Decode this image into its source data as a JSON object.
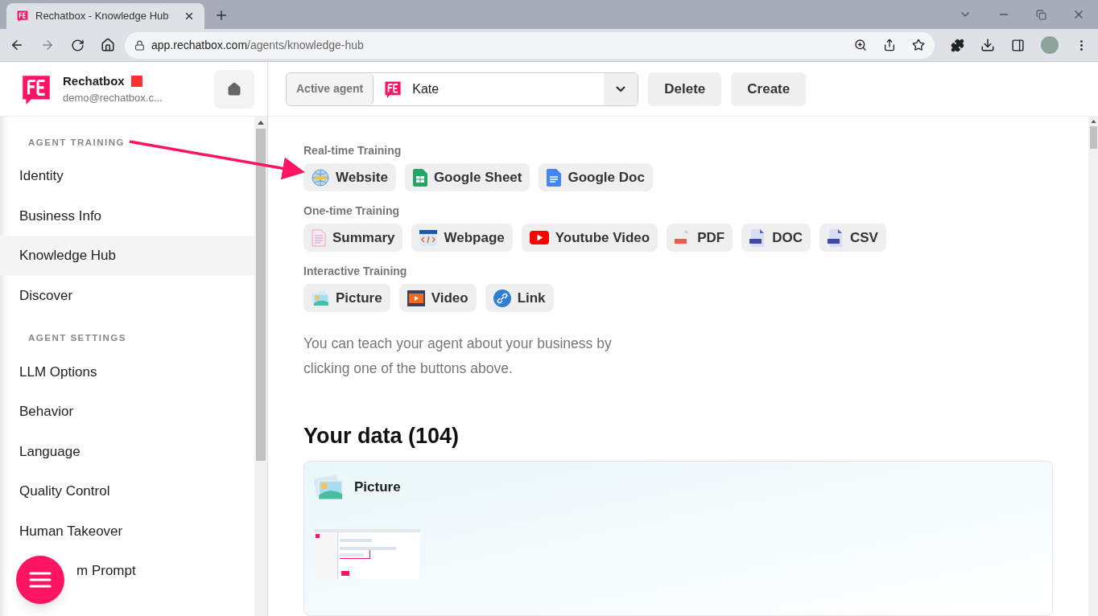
{
  "browser": {
    "tab_title": "Rechatbox - Knowledge Hub",
    "url_host": "app.rechatbox.com",
    "url_path": "/agents/knowledge-hub"
  },
  "brand": {
    "name": "Rechatbox",
    "email": "demo@rechatbox.c..."
  },
  "sidebar": [
    {
      "heading": "AGENT TRAINING",
      "items": [
        {
          "label": "Identity",
          "selected": false,
          "kind": "normal"
        },
        {
          "label": "Business Info",
          "selected": false,
          "kind": "normal"
        },
        {
          "label": "Knowledge Hub",
          "selected": true,
          "kind": "normal"
        },
        {
          "label": "Discover",
          "selected": false,
          "kind": "normal"
        }
      ]
    },
    {
      "heading": "AGENT SETTINGS",
      "items": [
        {
          "label": "LLM Options",
          "selected": false,
          "kind": "normal"
        },
        {
          "label": "Behavior",
          "selected": false,
          "kind": "normal"
        },
        {
          "label": "Language",
          "selected": false,
          "kind": "normal"
        },
        {
          "label": "Quality Control",
          "selected": false,
          "kind": "normal"
        },
        {
          "label": "Human Takeover",
          "selected": false,
          "kind": "normal"
        },
        {
          "label": "m Prompt",
          "selected": false,
          "kind": "covered"
        }
      ]
    }
  ],
  "agent": {
    "label": "Active agent",
    "value": "Kate"
  },
  "actions": [
    "Delete",
    "Create"
  ],
  "training": [
    {
      "title": "Real-time Training",
      "buttons": [
        {
          "label": "Website",
          "kind": "globe"
        },
        {
          "label": "Google Sheet",
          "kind": "sheet"
        },
        {
          "label": "Google Doc",
          "kind": "gdoc"
        }
      ]
    },
    {
      "title": "One-time Training",
      "buttons": [
        {
          "label": "Summary",
          "kind": "summary"
        },
        {
          "label": "Webpage",
          "kind": "webpage"
        },
        {
          "label": "Youtube Video",
          "kind": "youtube"
        },
        {
          "label": "PDF",
          "kind": "pdf"
        },
        {
          "label": "DOC",
          "kind": "docx"
        },
        {
          "label": "CSV",
          "kind": "csv"
        }
      ]
    },
    {
      "title": "Interactive Training",
      "buttons": [
        {
          "label": "Picture",
          "kind": "picture"
        },
        {
          "label": "Video",
          "kind": "video"
        },
        {
          "label": "Link",
          "kind": "link"
        }
      ]
    }
  ],
  "hint": "You can teach your agent about your business by clicking one of the buttons above.",
  "data_title": "Your data (104)",
  "cards": [
    {
      "kind": "picture",
      "title": "Picture"
    }
  ]
}
